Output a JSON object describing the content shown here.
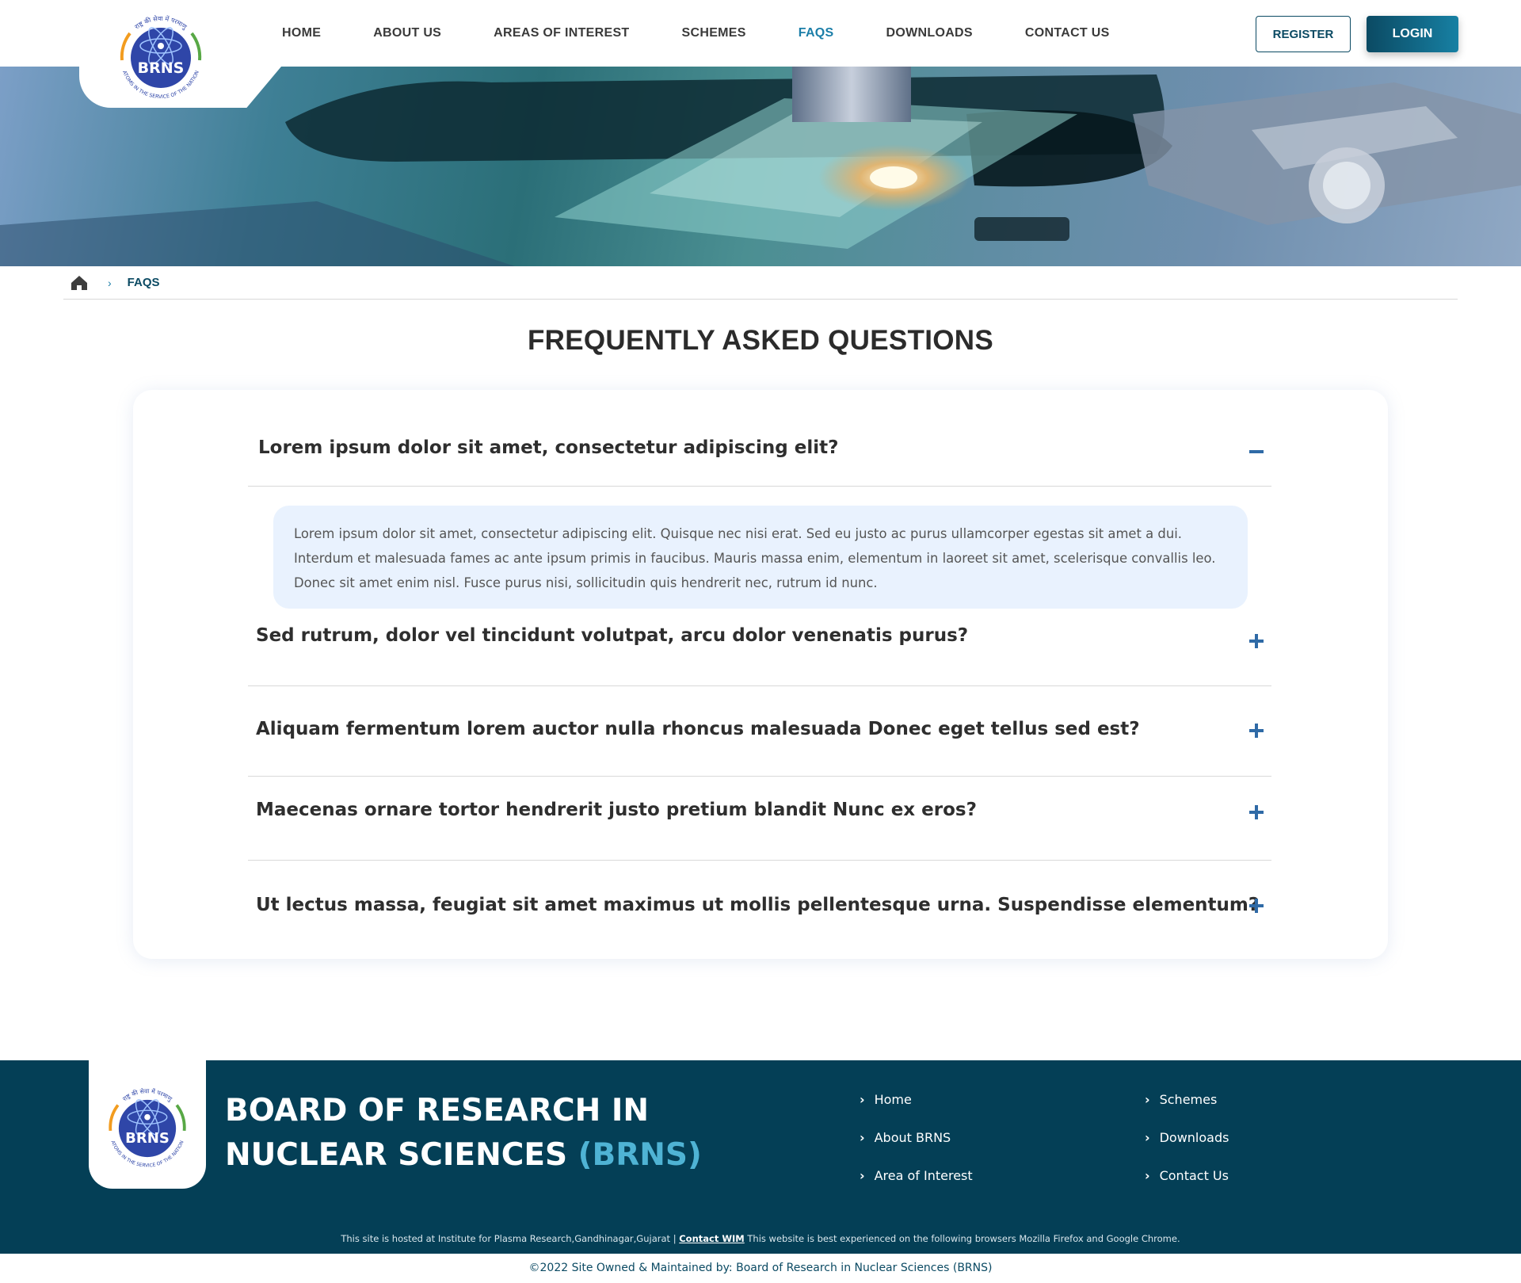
{
  "header": {
    "logo_text": "BRNS",
    "logo_ring_top": "राष्ट्र की सेवा में परमाणु",
    "logo_ring_bottom": "ATOMS IN THE SERVICE OF THE NATION",
    "nav": [
      {
        "label": "HOME",
        "active": false
      },
      {
        "label": "ABOUT US",
        "active": false
      },
      {
        "label": "AREAS OF INTEREST",
        "active": false
      },
      {
        "label": "SCHEMES",
        "active": false
      },
      {
        "label": "FAQS",
        "active": true
      },
      {
        "label": "DOWNLOADS",
        "active": false
      },
      {
        "label": "CONTACT US",
        "active": false
      }
    ],
    "register_label": "REGISTER",
    "login_label": "LOGIN"
  },
  "breadcrumb": {
    "home_icon": "home-icon",
    "separator_icon": "chevron-right-icon",
    "current": "FAQS"
  },
  "page": {
    "title": "FREQUENTLY ASKED QUESTIONS"
  },
  "faq": {
    "items": [
      {
        "question": "Lorem ipsum dolor sit amet, consectetur adipiscing elit?",
        "expanded": true,
        "answer": "Lorem ipsum dolor sit amet, consectetur adipiscing elit. Quisque nec nisi erat. Sed eu justo ac purus ullamcorper egestas sit amet a dui. Interdum et malesuada fames ac ante ipsum primis in faucibus. Mauris massa enim, elementum in laoreet sit amet, scelerisque convallis leo. Donec sit amet enim nisl. Fusce purus nisi, sollicitudin quis hendrerit nec, rutrum id nunc."
      },
      {
        "question": "Sed rutrum, dolor vel tincidunt volutpat, arcu dolor venenatis purus?",
        "expanded": false
      },
      {
        "question": "Aliquam fermentum lorem auctor nulla rhoncus malesuada Donec eget tellus sed est?",
        "expanded": false
      },
      {
        "question": "Maecenas ornare tortor hendrerit justo pretium blandit Nunc ex eros?",
        "expanded": false
      },
      {
        "question": "Ut lectus massa, feugiat sit amet maximus ut mollis pellentesque urna. Suspendisse elementum?",
        "expanded": false
      }
    ],
    "collapse_icon": "minus-icon",
    "expand_icon": "plus-icon"
  },
  "footer": {
    "title_line1": "BOARD OF RESEARCH IN",
    "title_line2": "NUCLEAR SCIENCES",
    "title_abbr": "(BRNS)",
    "links_col1": [
      "Home",
      "About BRNS",
      "Area of Interest"
    ],
    "links_col2": [
      "Schemes",
      "Downloads",
      "Contact Us"
    ],
    "note_pre": "This site is hosted at Institute for Plasma Research,Gandhinagar,Gujarat  |",
    "note_link": "Contact WIM",
    "note_post": "This website is best experienced on the following browsers Mozilla Firefox and Google Chrome.",
    "copyright": "©2022 Site Owned & Maintained by: Board of Research in Nuclear Sciences (BRNS)"
  },
  "colors": {
    "accent": "#1b7ea8",
    "dark_teal": "#0b4a63",
    "footer_bg": "#043f56",
    "answer_bg": "#e9f2fe",
    "toggle": "#2f6aa6"
  }
}
